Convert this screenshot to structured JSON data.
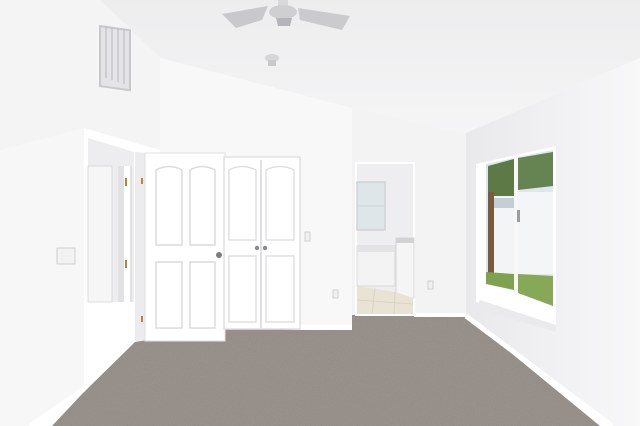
{
  "scene": {
    "subject": "empty-bedroom",
    "watermark": "",
    "colors": {
      "ceiling": "#f1f1f1",
      "wall_light": "#f6f6f6",
      "wall_shade": "#e7e7e9",
      "carpet": "#8c857f",
      "carpet_dark": "#77706b",
      "trim": "#ffffff",
      "door": "#ffffff",
      "door_panel_line": "#dcdcdf",
      "knob": "#7d7d80",
      "window_sky": "#d9e6ef",
      "tree": "#5d7a46",
      "grass": "#7ea24f",
      "tile": "#e9e3d6"
    }
  }
}
